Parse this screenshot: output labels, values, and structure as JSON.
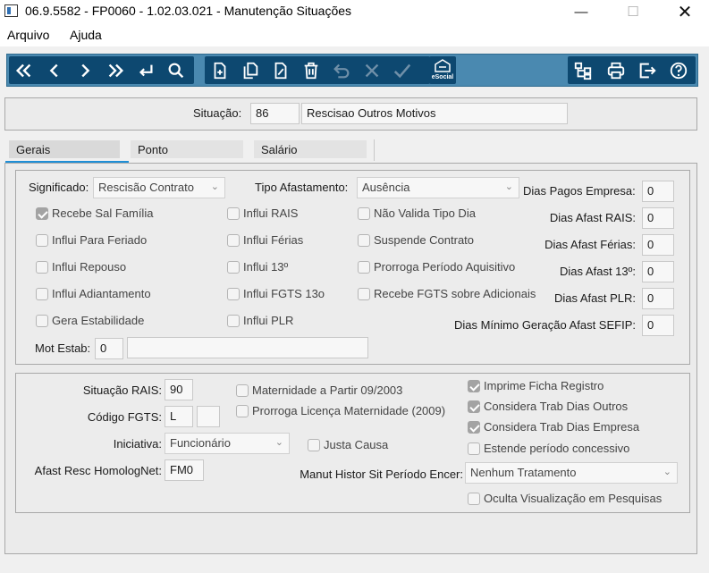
{
  "window": {
    "title": "06.9.5582 - FP0060 - 1.02.03.021 - Manutenção Situações",
    "minimize_icon": "minimize-icon",
    "maximize_icon": "maximize-icon",
    "close_icon": "close-icon",
    "min_glyph": "—",
    "max_glyph": "☐",
    "close_glyph": "✕"
  },
  "menu": {
    "items": [
      "Arquivo",
      "Ajuda"
    ]
  },
  "toolbar": {
    "esocial_label": "eSocial",
    "accent": "#0d4870",
    "background": "#4a89b0"
  },
  "header": {
    "situacao_label": "Situação:",
    "situacao_code": "86",
    "situacao_desc": "Rescisao Outros Motivos"
  },
  "tabs": [
    {
      "label": "Gerais",
      "active": true
    },
    {
      "label": "Ponto",
      "active": false
    },
    {
      "label": "Salário",
      "active": false
    }
  ],
  "gerais": {
    "significado_label": "Significado:",
    "significado_value": "Rescisão Contrato",
    "tipo_afast_label": "Tipo Afastamento:",
    "tipo_afast_value": "Ausência",
    "col1": [
      {
        "label": "Recebe Sal Família",
        "checked": true
      },
      {
        "label": "Influi Para Feriado",
        "checked": false
      },
      {
        "label": "Influi Repouso",
        "checked": false
      },
      {
        "label": "Influi Adiantamento",
        "checked": false
      },
      {
        "label": "Gera Estabilidade",
        "checked": false
      }
    ],
    "col2": [
      {
        "label": "Influi RAIS",
        "checked": false
      },
      {
        "label": "Influi Férias",
        "checked": false
      },
      {
        "label": "Influi 13º",
        "checked": false
      },
      {
        "label": "Influi FGTS 13o",
        "checked": false
      },
      {
        "label": "Influi PLR",
        "checked": false
      }
    ],
    "col3": [
      {
        "label": "Não Valida Tipo Dia",
        "checked": false
      },
      {
        "label": "Suspende Contrato",
        "checked": false
      },
      {
        "label": "Prorroga Período Aquisitivo",
        "checked": false
      },
      {
        "label": "Recebe FGTS sobre Adicionais",
        "checked": false
      }
    ],
    "dias": [
      {
        "label": "Dias Pagos Empresa:",
        "value": "0"
      },
      {
        "label": "Dias Afast RAIS:",
        "value": "0"
      },
      {
        "label": "Dias Afast Férias:",
        "value": "0"
      },
      {
        "label": "Dias Afast 13º:",
        "value": "0"
      },
      {
        "label": "Dias Afast PLR:",
        "value": "0"
      },
      {
        "label": "Dias Mínimo Geração Afast SEFIP:",
        "value": "0"
      }
    ],
    "mot_estab_label": "Mot Estab:",
    "mot_estab_code": "0",
    "mot_estab_desc": ""
  },
  "bottom": {
    "sit_rais_label": "Situação RAIS:",
    "sit_rais_value": "90",
    "cod_fgts_label": "Código FGTS:",
    "cod_fgts_value": "L",
    "cod_fgts_value2": "",
    "iniciativa_label": "Iniciativa:",
    "iniciativa_value": "Funcionário",
    "afast_homolog_label": "Afast Resc HomologNet:",
    "afast_homolog_value": "FM0",
    "manut_label": "Manut Histor Sit Período Encer:",
    "manut_value": "Nenhum Tratamento",
    "maternidade": [
      {
        "label": "Maternidade a Partir 09/2003",
        "checked": false
      },
      {
        "label": "Prorroga Licença Maternidade (2009)",
        "checked": false
      }
    ],
    "justa_causa": {
      "label": "Justa Causa",
      "checked": false
    },
    "right_checks": [
      {
        "label": "Imprime Ficha Registro",
        "checked": true
      },
      {
        "label": "Considera Trab Dias Outros",
        "checked": true
      },
      {
        "label": "Considera Trab Dias Empresa",
        "checked": true
      },
      {
        "label": "Estende período concessivo",
        "checked": false
      }
    ],
    "oculta": {
      "label": "Oculta Visualização em Pesquisas",
      "checked": false
    }
  }
}
